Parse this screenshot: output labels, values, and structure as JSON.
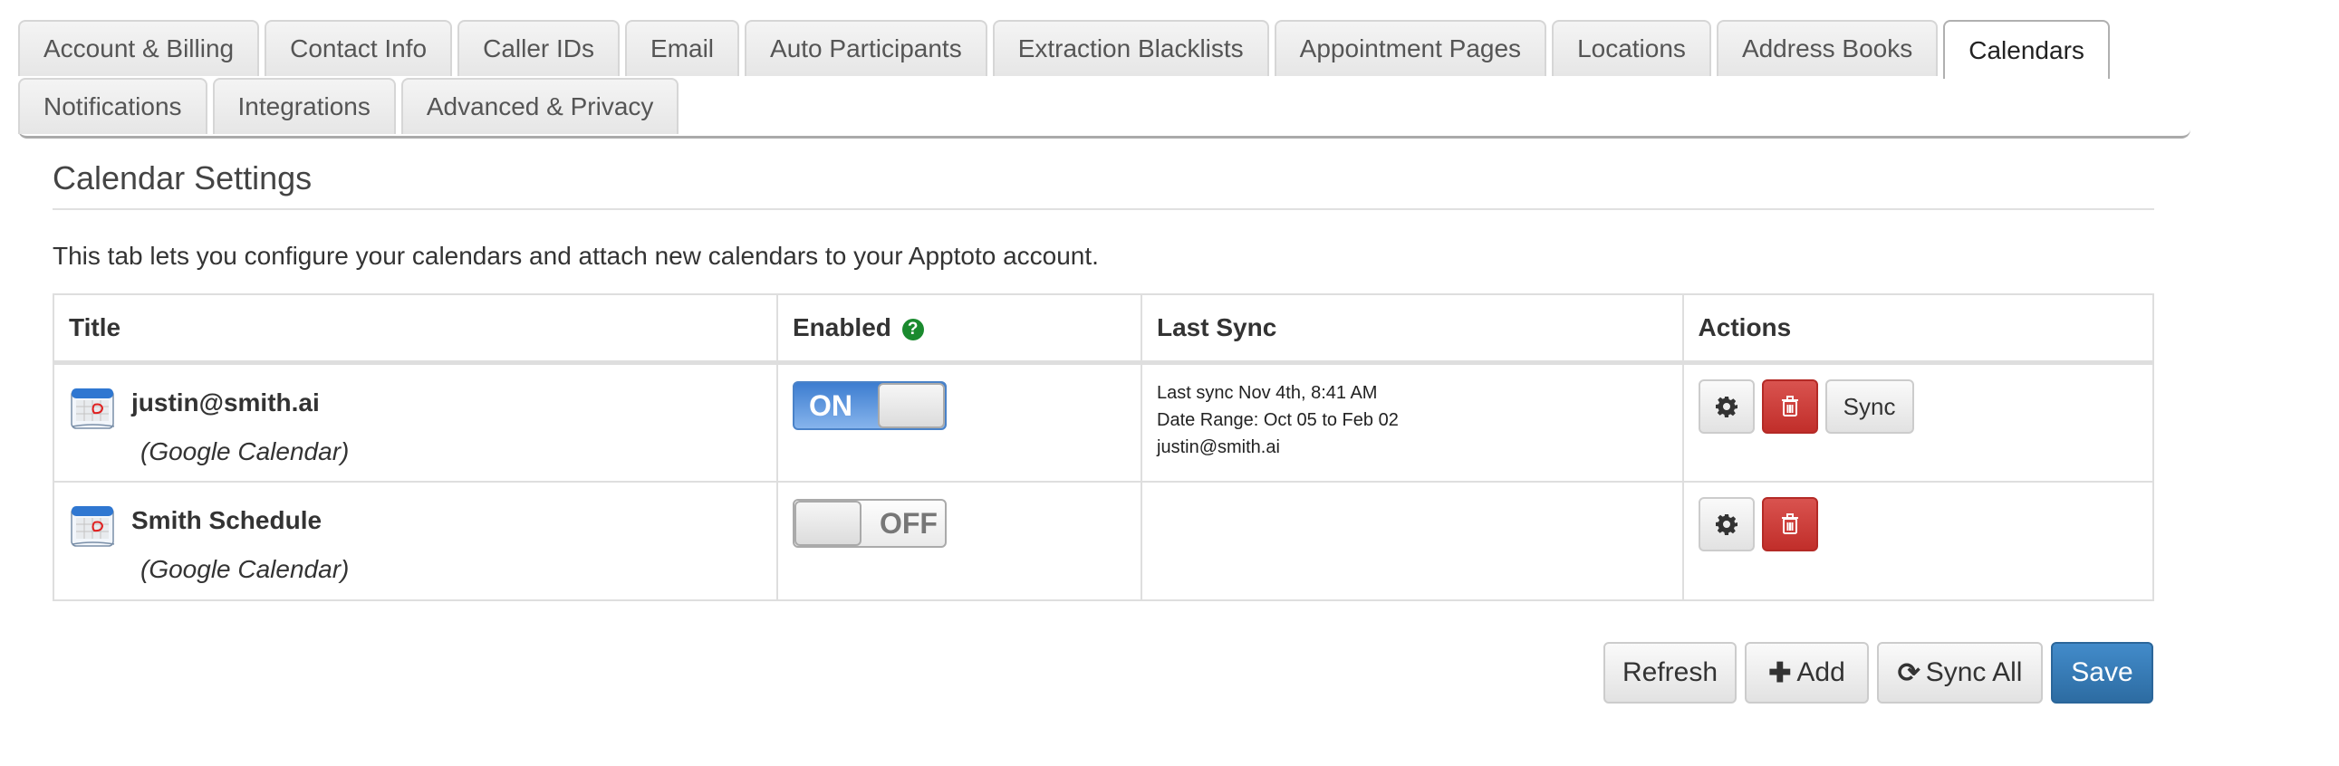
{
  "tabs": {
    "row1": [
      {
        "label": "Account & Billing",
        "active": false
      },
      {
        "label": "Contact Info",
        "active": false
      },
      {
        "label": "Caller IDs",
        "active": false
      },
      {
        "label": "Email",
        "active": false
      },
      {
        "label": "Auto Participants",
        "active": false
      },
      {
        "label": "Extraction Blacklists",
        "active": false
      },
      {
        "label": "Appointment Pages",
        "active": false
      },
      {
        "label": "Locations",
        "active": false
      },
      {
        "label": "Address Books",
        "active": false
      },
      {
        "label": "Calendars",
        "active": true
      }
    ],
    "row2": [
      {
        "label": "Notifications",
        "active": false
      },
      {
        "label": "Integrations",
        "active": false
      },
      {
        "label": "Advanced & Privacy",
        "active": false
      }
    ]
  },
  "page": {
    "heading": "Calendar Settings",
    "description": "This tab lets you configure your calendars and attach new calendars to your Apptoto account."
  },
  "table": {
    "headers": {
      "title": "Title",
      "enabled": "Enabled",
      "enabled_help_icon": "question-circle-icon",
      "last_sync": "Last Sync",
      "actions": "Actions"
    },
    "rows": [
      {
        "name": "justin@smith.ai",
        "type": "(Google Calendar)",
        "icon": "google-calendar-icon",
        "enabled": true,
        "toggle_label": "ON",
        "last_sync": "Last sync Nov 4th, 8:41 AM",
        "date_range": "Date Range: Oct 05 to Feb 02",
        "sync_account": "justin@smith.ai",
        "actions": {
          "settings_icon": "gear-icon",
          "delete_icon": "trash-icon",
          "sync_label": "Sync"
        }
      },
      {
        "name": "Smith Schedule",
        "type": "(Google Calendar)",
        "icon": "google-calendar-icon",
        "enabled": false,
        "toggle_label": "OFF",
        "last_sync": "",
        "date_range": "",
        "sync_account": "",
        "actions": {
          "settings_icon": "gear-icon",
          "delete_icon": "trash-icon"
        }
      }
    ]
  },
  "footer": {
    "refresh_label": "Refresh",
    "add_label": "Add",
    "sync_all_label": "Sync All",
    "save_label": "Save"
  },
  "colors": {
    "primary": "#337ab7",
    "danger": "#c9302c",
    "toggle_on": "#4a86d4",
    "help_icon": "#1a8a2e"
  }
}
